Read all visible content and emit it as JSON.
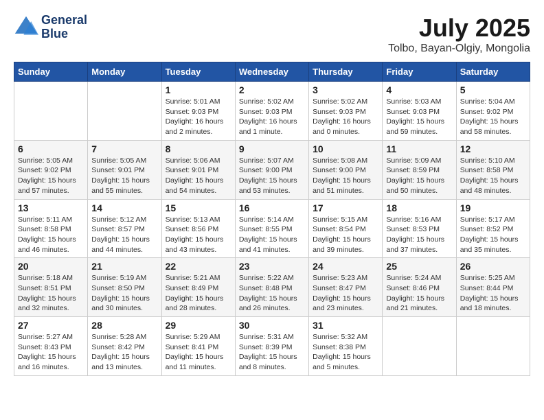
{
  "header": {
    "logo_line1": "General",
    "logo_line2": "Blue",
    "month_year": "July 2025",
    "location": "Tolbo, Bayan-Olgiy, Mongolia"
  },
  "calendar": {
    "weekdays": [
      "Sunday",
      "Monday",
      "Tuesday",
      "Wednesday",
      "Thursday",
      "Friday",
      "Saturday"
    ],
    "weeks": [
      [
        {
          "day": "",
          "info": ""
        },
        {
          "day": "",
          "info": ""
        },
        {
          "day": "1",
          "info": "Sunrise: 5:01 AM\nSunset: 9:03 PM\nDaylight: 16 hours\nand 2 minutes."
        },
        {
          "day": "2",
          "info": "Sunrise: 5:02 AM\nSunset: 9:03 PM\nDaylight: 16 hours\nand 1 minute."
        },
        {
          "day": "3",
          "info": "Sunrise: 5:02 AM\nSunset: 9:03 PM\nDaylight: 16 hours\nand 0 minutes."
        },
        {
          "day": "4",
          "info": "Sunrise: 5:03 AM\nSunset: 9:03 PM\nDaylight: 15 hours\nand 59 minutes."
        },
        {
          "day": "5",
          "info": "Sunrise: 5:04 AM\nSunset: 9:02 PM\nDaylight: 15 hours\nand 58 minutes."
        }
      ],
      [
        {
          "day": "6",
          "info": "Sunrise: 5:05 AM\nSunset: 9:02 PM\nDaylight: 15 hours\nand 57 minutes."
        },
        {
          "day": "7",
          "info": "Sunrise: 5:05 AM\nSunset: 9:01 PM\nDaylight: 15 hours\nand 55 minutes."
        },
        {
          "day": "8",
          "info": "Sunrise: 5:06 AM\nSunset: 9:01 PM\nDaylight: 15 hours\nand 54 minutes."
        },
        {
          "day": "9",
          "info": "Sunrise: 5:07 AM\nSunset: 9:00 PM\nDaylight: 15 hours\nand 53 minutes."
        },
        {
          "day": "10",
          "info": "Sunrise: 5:08 AM\nSunset: 9:00 PM\nDaylight: 15 hours\nand 51 minutes."
        },
        {
          "day": "11",
          "info": "Sunrise: 5:09 AM\nSunset: 8:59 PM\nDaylight: 15 hours\nand 50 minutes."
        },
        {
          "day": "12",
          "info": "Sunrise: 5:10 AM\nSunset: 8:58 PM\nDaylight: 15 hours\nand 48 minutes."
        }
      ],
      [
        {
          "day": "13",
          "info": "Sunrise: 5:11 AM\nSunset: 8:58 PM\nDaylight: 15 hours\nand 46 minutes."
        },
        {
          "day": "14",
          "info": "Sunrise: 5:12 AM\nSunset: 8:57 PM\nDaylight: 15 hours\nand 44 minutes."
        },
        {
          "day": "15",
          "info": "Sunrise: 5:13 AM\nSunset: 8:56 PM\nDaylight: 15 hours\nand 43 minutes."
        },
        {
          "day": "16",
          "info": "Sunrise: 5:14 AM\nSunset: 8:55 PM\nDaylight: 15 hours\nand 41 minutes."
        },
        {
          "day": "17",
          "info": "Sunrise: 5:15 AM\nSunset: 8:54 PM\nDaylight: 15 hours\nand 39 minutes."
        },
        {
          "day": "18",
          "info": "Sunrise: 5:16 AM\nSunset: 8:53 PM\nDaylight: 15 hours\nand 37 minutes."
        },
        {
          "day": "19",
          "info": "Sunrise: 5:17 AM\nSunset: 8:52 PM\nDaylight: 15 hours\nand 35 minutes."
        }
      ],
      [
        {
          "day": "20",
          "info": "Sunrise: 5:18 AM\nSunset: 8:51 PM\nDaylight: 15 hours\nand 32 minutes."
        },
        {
          "day": "21",
          "info": "Sunrise: 5:19 AM\nSunset: 8:50 PM\nDaylight: 15 hours\nand 30 minutes."
        },
        {
          "day": "22",
          "info": "Sunrise: 5:21 AM\nSunset: 8:49 PM\nDaylight: 15 hours\nand 28 minutes."
        },
        {
          "day": "23",
          "info": "Sunrise: 5:22 AM\nSunset: 8:48 PM\nDaylight: 15 hours\nand 26 minutes."
        },
        {
          "day": "24",
          "info": "Sunrise: 5:23 AM\nSunset: 8:47 PM\nDaylight: 15 hours\nand 23 minutes."
        },
        {
          "day": "25",
          "info": "Sunrise: 5:24 AM\nSunset: 8:46 PM\nDaylight: 15 hours\nand 21 minutes."
        },
        {
          "day": "26",
          "info": "Sunrise: 5:25 AM\nSunset: 8:44 PM\nDaylight: 15 hours\nand 18 minutes."
        }
      ],
      [
        {
          "day": "27",
          "info": "Sunrise: 5:27 AM\nSunset: 8:43 PM\nDaylight: 15 hours\nand 16 minutes."
        },
        {
          "day": "28",
          "info": "Sunrise: 5:28 AM\nSunset: 8:42 PM\nDaylight: 15 hours\nand 13 minutes."
        },
        {
          "day": "29",
          "info": "Sunrise: 5:29 AM\nSunset: 8:41 PM\nDaylight: 15 hours\nand 11 minutes."
        },
        {
          "day": "30",
          "info": "Sunrise: 5:31 AM\nSunset: 8:39 PM\nDaylight: 15 hours\nand 8 minutes."
        },
        {
          "day": "31",
          "info": "Sunrise: 5:32 AM\nSunset: 8:38 PM\nDaylight: 15 hours\nand 5 minutes."
        },
        {
          "day": "",
          "info": ""
        },
        {
          "day": "",
          "info": ""
        }
      ]
    ]
  }
}
